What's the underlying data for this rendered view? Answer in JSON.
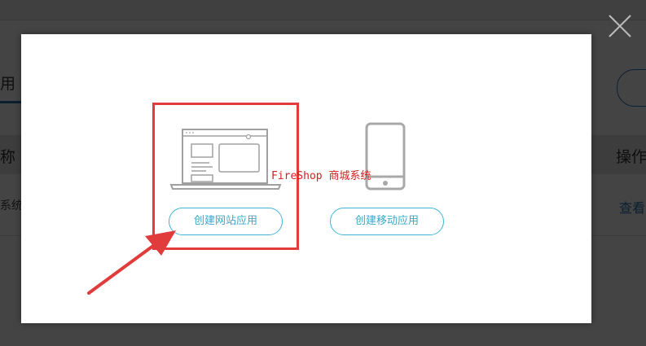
{
  "background": {
    "tab_label": "用",
    "column_left": "称",
    "column_right": "操作",
    "row_left": "系统",
    "row_action": "查看"
  },
  "dialog": {
    "options": [
      {
        "label": "创建网站应用",
        "icon": "laptop-icon"
      },
      {
        "label": "创建移动应用",
        "icon": "phone-icon"
      }
    ],
    "close_icon": "close-icon"
  },
  "watermark": "FireShop 商城系统",
  "colors": {
    "accent": "#3fb5d6",
    "highlight": "#e23b3b",
    "watermark": "#d21f1f",
    "icon": "#a0a0a0"
  }
}
